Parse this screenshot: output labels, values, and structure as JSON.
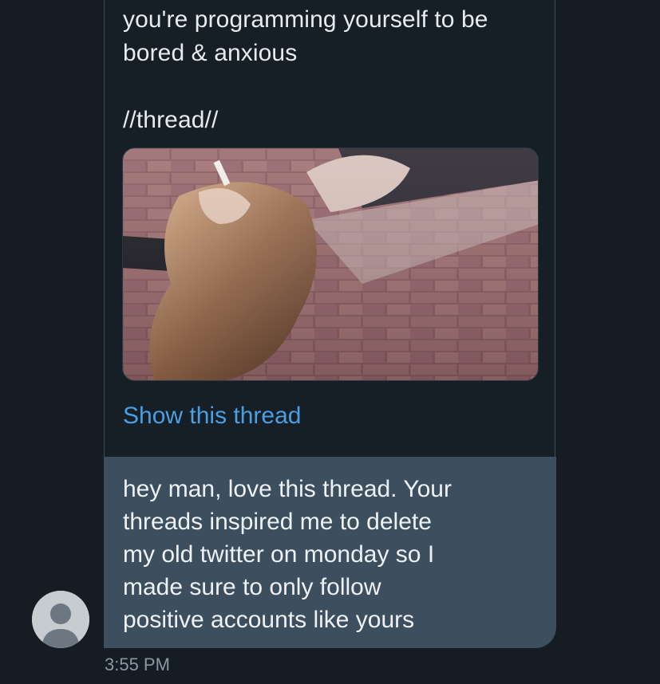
{
  "quoted_tweet": {
    "text_lines": [
      "you're programming yourself to be",
      "bored & anxious",
      "",
      "//thread//"
    ],
    "image_description_icon": "photo-woman-smoking-brick-wall",
    "show_thread_label": "Show this thread"
  },
  "message": {
    "lines": [
      "hey man, love this thread. Your",
      "threads inspired me to delete",
      "my old twitter on monday so I",
      "made sure to only follow",
      "positive accounts like yours"
    ],
    "timestamp": "3:55 PM"
  },
  "avatar": {
    "icon": "default-user-avatar-icon"
  },
  "colors": {
    "background": "#151c24",
    "bubble": "#3d4e5f",
    "link": "#4a9fe3",
    "text": "#e7ebee",
    "muted": "#8a98a6"
  }
}
